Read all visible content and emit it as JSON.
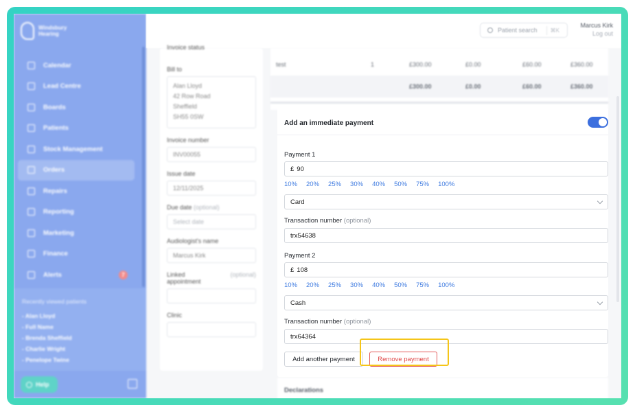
{
  "sidebar": {
    "brand": "Windsbury Hearing",
    "items": [
      {
        "label": "Calendar",
        "icon": "calendar-icon"
      },
      {
        "label": "Lead Centre",
        "icon": "headset-icon"
      },
      {
        "label": "Boards",
        "icon": "board-icon"
      },
      {
        "label": "Patients",
        "icon": "patients-icon"
      },
      {
        "label": "Stock Management",
        "icon": "clipboard-icon"
      },
      {
        "label": "Orders",
        "icon": "orders-icon"
      },
      {
        "label": "Repairs",
        "icon": "wrench-icon"
      },
      {
        "label": "Reporting",
        "icon": "chart-icon"
      },
      {
        "label": "Marketing",
        "icon": "mail-icon"
      },
      {
        "label": "Finance",
        "icon": "card-icon"
      },
      {
        "label": "Alerts",
        "icon": "bell-icon",
        "badge": "7"
      }
    ],
    "active_item": "Orders",
    "recent_title": "Recently viewed patients",
    "recent": [
      "- Alan Lloyd",
      "- Full Name",
      "- Brenda Sheffield",
      "- Charlie Wright",
      "- Penelope Twine"
    ],
    "help_label": "Help"
  },
  "topbar": {
    "search_placeholder": "Patient search",
    "search_shortcut": "⌘K",
    "user_name": "Marcus Kirk",
    "logout": "Log out"
  },
  "invoice_form": {
    "top_label": "Invoice status",
    "bill_to_label": "Bill to",
    "bill_to": [
      "Alan Lloyd",
      "42 Row Road",
      "Sheffield",
      "SH55 0SW"
    ],
    "invoice_number_label": "Invoice number",
    "invoice_number": "INV00055",
    "issue_date_label": "Issue date",
    "issue_date": "12/11/2025",
    "due_date_label": "Due date",
    "due_date_opt": "(optional)",
    "due_date_placeholder": "Select date",
    "audiologist_label": "Audiologist's name",
    "audiologist": "Marcus Kirk",
    "linked_label": "Linked appointment",
    "linked_opt": "(optional)",
    "clinic_label": "Clinic"
  },
  "items_table": {
    "row": [
      "test",
      "1",
      "£300.00",
      "£0.00",
      "£60.00",
      "£360.00"
    ],
    "totals": [
      "£300.00",
      "£0.00",
      "£60.00",
      "£360.00"
    ]
  },
  "payment": {
    "title": "Add an immediate payment",
    "toggle_on": true,
    "percent_options": [
      "10%",
      "20%",
      "25%",
      "30%",
      "40%",
      "50%",
      "75%",
      "100%"
    ],
    "currency_symbol": "£",
    "payments": [
      {
        "label": "Payment 1",
        "amount": "90",
        "method": "Card",
        "txn_label": "Transaction number",
        "txn_opt": "(optional)",
        "txn": "trx54638"
      },
      {
        "label": "Payment 2",
        "amount": "108",
        "method": "Cash",
        "txn_label": "Transaction number",
        "txn_opt": "(optional)",
        "txn": "trx64364"
      }
    ],
    "add_button": "Add another payment",
    "remove_button": "Remove payment"
  },
  "declarations": {
    "title": "Declarations"
  },
  "colors": {
    "sidebar": "#8aa8ee",
    "accent": "#3c6fde",
    "link": "#3f7be0",
    "danger": "#e04848",
    "highlight": "#f5c518",
    "frame": "#34d3c4"
  }
}
